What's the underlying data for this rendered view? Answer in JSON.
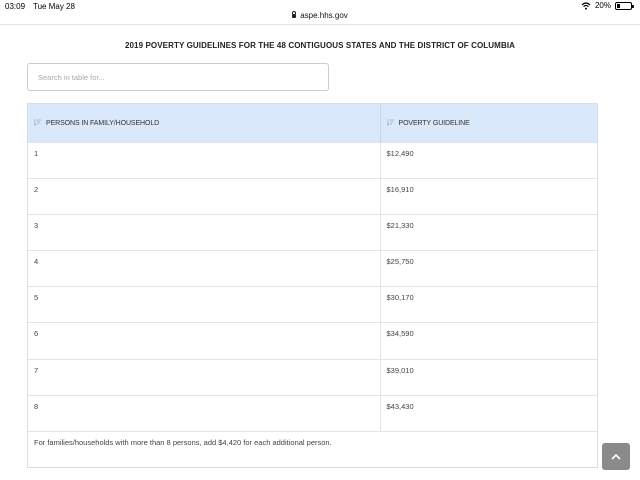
{
  "status": {
    "time": "03:09",
    "date": "Tue May 28",
    "battery": "20%"
  },
  "browser": {
    "url": "aspe.hhs.gov"
  },
  "page": {
    "title": "2019 POVERTY GUIDELINES FOR THE 48 CONTIGUOUS STATES AND THE DISTRICT OF COLUMBIA"
  },
  "search": {
    "placeholder": "Search in table for..."
  },
  "table": {
    "headers": [
      "PERSONS IN FAMILY/HOUSEHOLD",
      "POVERTY GUIDELINE"
    ],
    "rows": [
      [
        "1",
        "$12,490"
      ],
      [
        "2",
        "$16,910"
      ],
      [
        "3",
        "$21,330"
      ],
      [
        "4",
        "$25,750"
      ],
      [
        "5",
        "$30,170"
      ],
      [
        "6",
        "$34,590"
      ],
      [
        "7",
        "$39,010"
      ],
      [
        "8",
        "$43,430"
      ]
    ],
    "footer": "For families/households with more than 8 persons, add $4,420 for each additional person."
  },
  "icons": {
    "sort": "sort-icon",
    "scroll_top": "chevron-up-icon",
    "wifi": "wifi-icon",
    "lock": "lock-icon",
    "battery": "battery-icon"
  },
  "colors": {
    "header_bg": "#d9e8fa",
    "scroll_button": "#8a8a8a"
  }
}
